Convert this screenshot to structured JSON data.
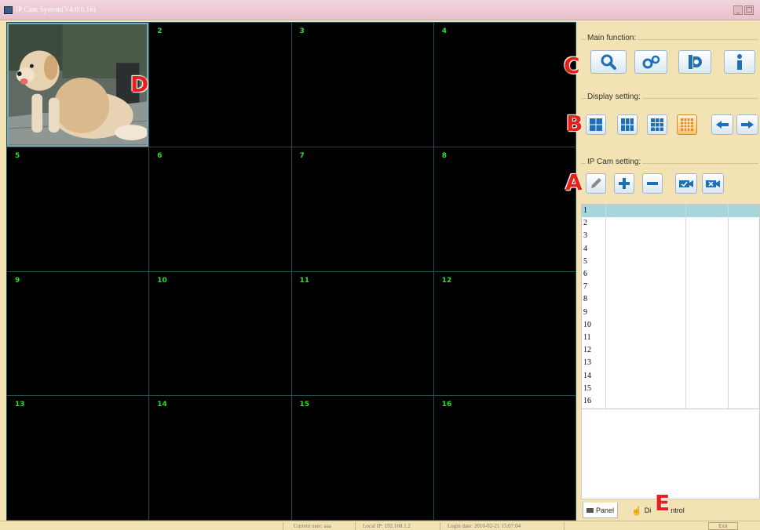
{
  "window": {
    "title": "IP Cam System(V4.0.0.16)",
    "minimize_icon": "minimize-icon",
    "maximize_icon": "maximize-icon"
  },
  "grid": {
    "channels": [
      "1",
      "2",
      "3",
      "4",
      "5",
      "6",
      "7",
      "8",
      "9",
      "10",
      "11",
      "12",
      "13",
      "14",
      "15",
      "16"
    ],
    "active_channel": "1"
  },
  "panel": {
    "main_function_label": "Main function:",
    "main_buttons": [
      "search-icon",
      "settings-icon",
      "record-icon",
      "info-icon"
    ],
    "display_setting_label": "Display setting:",
    "display_buttons": [
      "layout-4-icon",
      "layout-6-icon",
      "layout-9-icon",
      "layout-16-icon",
      "arrow-left-icon",
      "arrow-right-icon"
    ],
    "ipcam_setting_label": "IP Cam setting:",
    "ipcam_buttons": [
      "edit-icon",
      "add-icon",
      "remove-icon",
      "connect-icon",
      "disconnect-icon"
    ],
    "table_rows": [
      "1",
      "2",
      "3",
      "4",
      "5",
      "6",
      "7",
      "8",
      "9",
      "10",
      "11",
      "12",
      "13",
      "14",
      "15",
      "16"
    ],
    "tabs": [
      {
        "label": "Panel",
        "icon": "camera-icon"
      },
      {
        "label": "Di",
        "icon": "hand-icon"
      },
      {
        "label": "ntrol",
        "icon": ""
      }
    ]
  },
  "markers": {
    "a": "A",
    "b": "B",
    "c": "C",
    "d": "D",
    "e": "E"
  },
  "statusbar": {
    "current_user": "Current user: aaa",
    "local_ip": "Local IP: 192.168.1.2",
    "login_date": "Login date: 2010-02-21 15:07:04",
    "exit_label": "Exit"
  },
  "colors": {
    "panel_bg": "#f3e2b3",
    "channel_number": "#2ddc2d",
    "grid_line": "#1f4f57",
    "marker": "#e8201a",
    "button_blue": "#1f6fb8"
  }
}
